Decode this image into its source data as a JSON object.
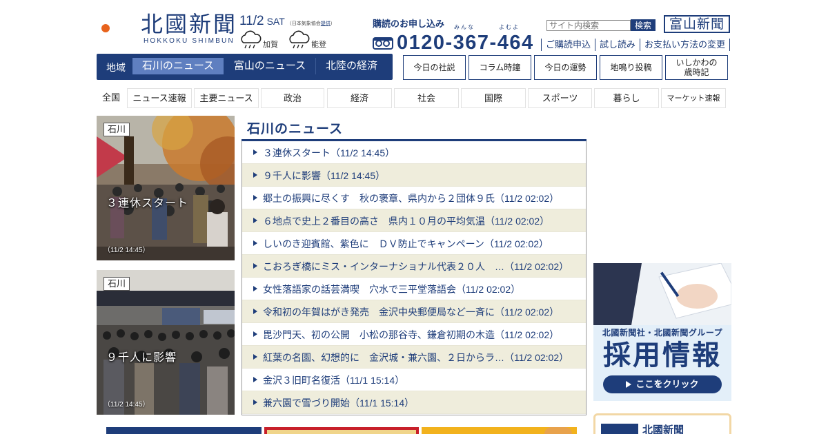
{
  "brand": {
    "name_jp": "北國新聞",
    "name_en": "HOKKOKU SHIMBUN",
    "colors": {
      "navy": "#1e3d7a",
      "accent_orange": "#e8631c",
      "active_tab": "#5f7fc0",
      "row_alt": "#efeddc"
    }
  },
  "date": {
    "main": "11/2",
    "day": "SAT",
    "source": "（日本気象協会",
    "source_link": "提供",
    "source_end": "）"
  },
  "weather": [
    {
      "area": "加賀",
      "icon": "cloudy-rain-icon"
    },
    {
      "area": "能登",
      "icon": "cloudy-rain-icon"
    }
  ],
  "subscribe": {
    "title": "購読のお申し込み",
    "ruby_1": "みんな",
    "ruby_2": "よむよ",
    "phone": "0120-367-464",
    "icon": "freedial-icon"
  },
  "search": {
    "placeholder": "サイト内検索",
    "button": "検索"
  },
  "toyama_button": "富山新聞",
  "util_links": [
    "ご購読申込",
    "試し読み",
    "お支払い方法の変更"
  ],
  "region_nav": {
    "label": "地域",
    "tabs": [
      {
        "label": "石川のニュース",
        "active": true
      },
      {
        "label": "富山のニュース",
        "active": false
      },
      {
        "label": "北陸の経済",
        "active": false
      }
    ]
  },
  "quick_links": [
    {
      "label": "今日の社説"
    },
    {
      "label": "コラム時鐘"
    },
    {
      "label": "今日の運勢"
    },
    {
      "label": "地鳴り投稿"
    },
    {
      "label": "いしかわの",
      "label2": "歳時記"
    }
  ],
  "categories": [
    "全国",
    "ニュース速報",
    "主要ニュース",
    "政治",
    "経済",
    "社会",
    "国際",
    "スポーツ",
    "暮らし",
    "マーケット速報"
  ],
  "features": [
    {
      "tag": "石川",
      "headline": "３連休スタート",
      "time": "（11/2 14:45）"
    },
    {
      "tag": "石川",
      "headline": "９千人に影響",
      "time": "（11/2 14:45）"
    }
  ],
  "news": {
    "title": "石川のニュース",
    "items": [
      "３連休スタート（11/2 14:45）",
      "９千人に影響（11/2 14:45）",
      "郷土の振興に尽くす　秋の褒章、県内から２団体９氏（11/2 02:02）",
      "６地点で史上２番目の高さ　県内１０月の平均気温（11/2 02:02）",
      "しいのき迎賓館、紫色に　ＤＶ防止でキャンペーン（11/2 02:02）",
      "こおろぎ橋にミス・インターナショナル代表２０人　…（11/2 02:02）",
      "女性落語家の話芸満喫　穴水で三平堂落語会（11/2 02:02）",
      "令和初の年賀はがき発売　金沢中央郵便局など一斉に（11/2 02:02）",
      "毘沙門天、初の公開　小松の那谷寺、鎌倉初期の木造（11/2 02:02）",
      "紅葉の名園、幻想的に　金沢城・兼六園、２日からラ…（11/2 02:02）",
      "金沢３旧町名復活（11/1 15:14）",
      "兼六園で雪づり開始（11/1 15:14）"
    ]
  },
  "recruit": {
    "sub": "北國新聞社・北國新聞グループ",
    "main": "採用情報",
    "button": "ここをクリック"
  },
  "side_box": {
    "title": "北國新聞"
  }
}
